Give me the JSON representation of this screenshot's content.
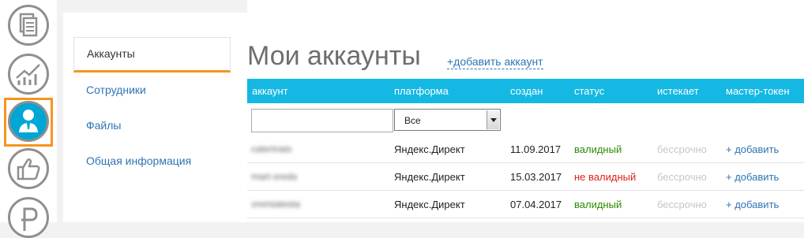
{
  "rail": {
    "icons": [
      "documents-icon",
      "chart-icon",
      "user-icon",
      "thumbs-up-icon",
      "ruble-icon"
    ],
    "accent": "#f7941d"
  },
  "subnav": {
    "items": [
      "Аккаунты",
      "Сотрудники",
      "Файлы",
      "Общая информация"
    ]
  },
  "main": {
    "title": "Мои аккаунты",
    "add_account": "+добавить аккаунт"
  },
  "table": {
    "headers": [
      "аккаунт",
      "платформа",
      "создан",
      "статус",
      "истекает",
      "мастер-токен"
    ],
    "filter": {
      "account_value": "",
      "platform_value": "Все"
    },
    "rows": [
      {
        "account": "caterinais",
        "platform": "Яндекс.Директ",
        "created": "11.09.2017",
        "status": "валидный",
        "expires": "бессрочно",
        "token": "+ добавить"
      },
      {
        "account": "mart-sreda",
        "platform": "Яндекс.Директ",
        "created": "15.03.2017",
        "status": "не валидный",
        "expires": "бессрочно",
        "token": "+ добавить"
      },
      {
        "account": "vremiatesta",
        "platform": "Яндекс.Директ",
        "created": "07.04.2017",
        "status": "валидный",
        "expires": "бессрочно",
        "token": "+ добавить"
      }
    ],
    "header_color": "#14b8e3",
    "valid_color": "#2e8b00",
    "invalid_color": "#e0201a"
  }
}
